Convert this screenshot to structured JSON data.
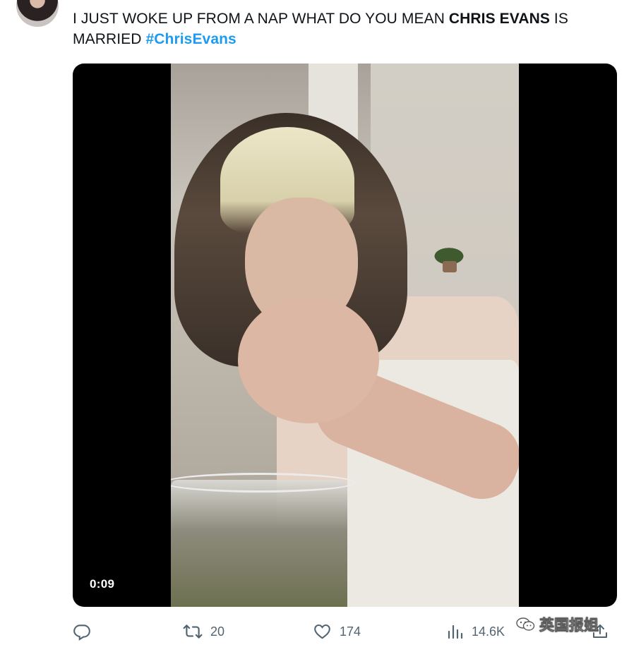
{
  "tweet": {
    "text_part1": "I JUST WOKE UP FROM A NAP WHAT DO YOU MEAN ",
    "text_bold": "CHRIS EVANS",
    "text_part2": " IS MARRIED ",
    "hashtag": "#ChrisEvans"
  },
  "media": {
    "duration": "0:09"
  },
  "actions": {
    "reply": {
      "icon": "reply-icon",
      "count": ""
    },
    "retweet": {
      "icon": "retweet-icon",
      "count": "20"
    },
    "like": {
      "icon": "heart-icon",
      "count": "174"
    },
    "views": {
      "icon": "views-icon",
      "count": "14.6K"
    },
    "share": {
      "icon": "share-icon"
    }
  },
  "watermark": {
    "text": "英国报姐",
    "icon": "wechat-icon"
  },
  "colors": {
    "text": "#0f1419",
    "secondary": "#536471",
    "hashtag": "#1d9bf0",
    "media_bg": "#000000"
  }
}
